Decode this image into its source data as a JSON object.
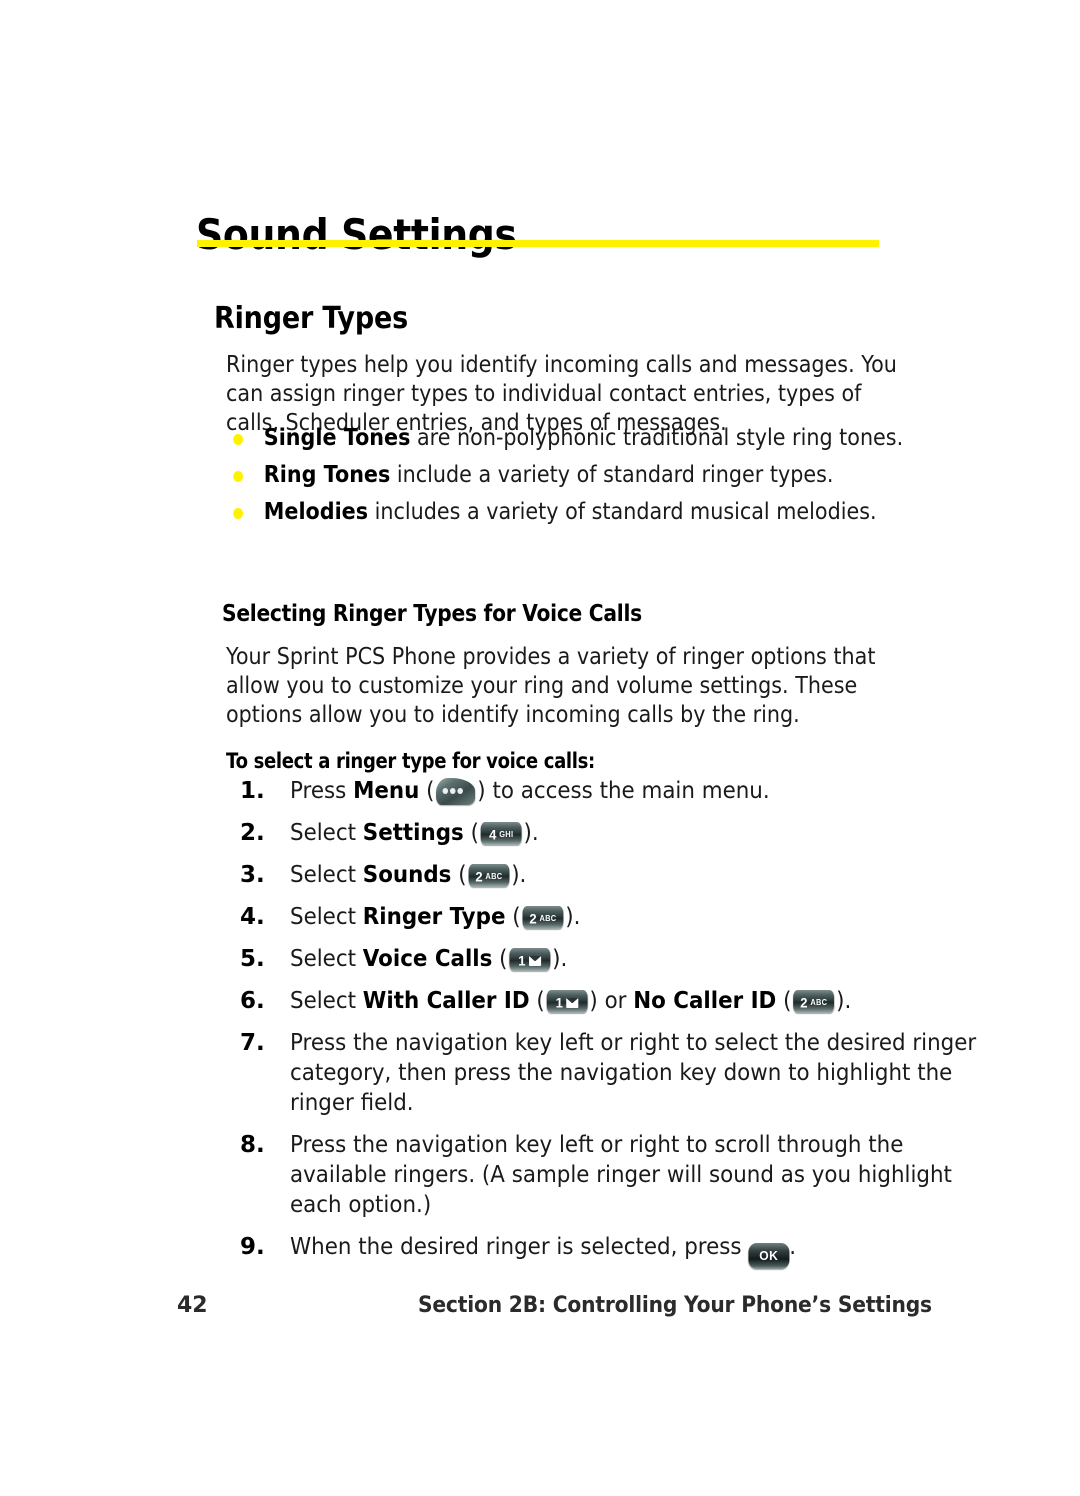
{
  "document": {
    "chapter_title": "Sound Settings",
    "section_title": "Ringer Types",
    "accent_color": "#fff200",
    "bullet_color": "#fff200",
    "key_color": "#2a3535"
  },
  "intro": {
    "paragraph": "Ringer types help you identify incoming calls and messages. You can assign ringer types to individual contact entries, types of calls, Scheduler entries, and types of messages."
  },
  "bullets": [
    {
      "term": "Single Tones",
      "rest": " are non-polyphonic traditional style ring tones."
    },
    {
      "term": "Ring Tones",
      "rest": " include a variety of standard ringer types."
    },
    {
      "term": "Melodies",
      "rest": " includes a variety of standard musical melodies."
    }
  ],
  "subsection": {
    "title": "Selecting Ringer Types for Voice Calls",
    "paragraph": "Your Sprint PCS Phone provides a variety of ringer options that allow you to customize your ring and volume settings. These options allow you to identify incoming calls by the ring.",
    "lead_in": "To select a ringer type for voice calls:"
  },
  "steps": [
    {
      "num": "1.",
      "pre": "Press ",
      "bold": "Menu",
      "mid": " (",
      "key": "menu-softkey",
      "post": ") to access the main menu."
    },
    {
      "num": "2.",
      "pre": "Select ",
      "bold": "Settings",
      "mid": " (",
      "key": "key-4-ghi",
      "key_num": "4",
      "key_letters": "GHI",
      "post": ")."
    },
    {
      "num": "3.",
      "pre": "Select ",
      "bold": "Sounds",
      "mid": " (",
      "key": "key-2-abc",
      "key_num": "2",
      "key_letters": "ABC",
      "post": ")."
    },
    {
      "num": "4.",
      "pre": "Select ",
      "bold": "Ringer Type",
      "mid": " (",
      "key": "key-2-abc",
      "key_num": "2",
      "key_letters": "ABC",
      "post": ")."
    },
    {
      "num": "5.",
      "pre": "Select ",
      "bold": "Voice Calls",
      "mid": " (",
      "key": "key-1-envelope",
      "key_num": "1",
      "post": ")."
    },
    {
      "num": "6.",
      "pre": "Select ",
      "bold": "With Caller ID",
      "mid": " (",
      "key": "key-1-envelope",
      "key_num": "1",
      "mid2": ") or ",
      "bold2": "No Caller ID",
      "mid3": " (",
      "key2": "key-2-abc",
      "key2_num": "2",
      "key2_letters": "ABC",
      "post": ")."
    },
    {
      "num": "7.",
      "text": "Press the navigation key left or right to select the desired ringer category, then press the navigation key down to highlight the ringer field."
    },
    {
      "num": "8.",
      "text": "Press the navigation key left or right to scroll through the available ringers. (A sample ringer will sound as you highlight each option.)"
    },
    {
      "num": "9.",
      "pre": "When the desired ringer is selected, press ",
      "key": "key-ok",
      "key_label": "OK",
      "post": "."
    }
  ],
  "footer": {
    "page_number": "42",
    "section_label": "Section 2B: Controlling Your Phone’s Settings"
  }
}
